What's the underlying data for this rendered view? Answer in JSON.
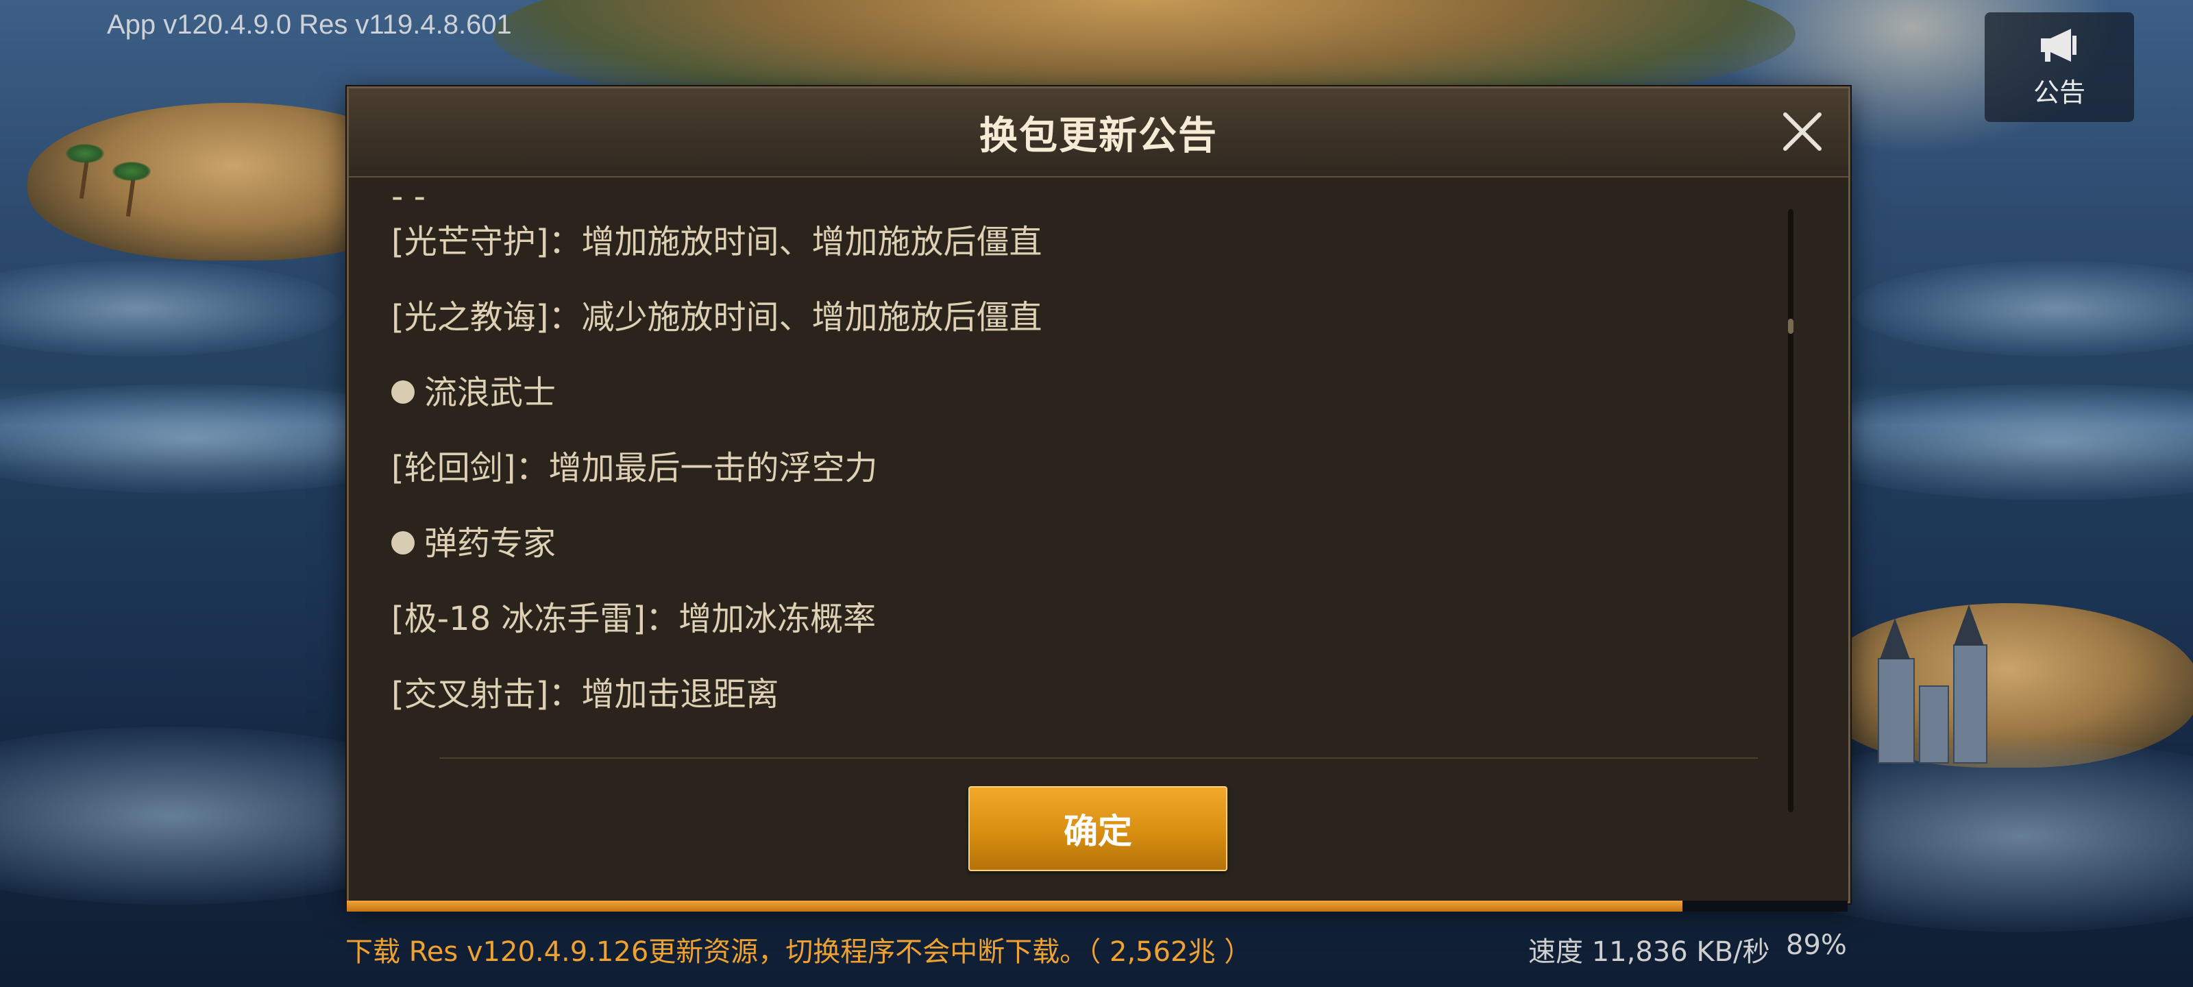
{
  "header": {
    "version_text": "App v120.4.9.0 Res v119.4.8.601",
    "notice_label": "公告"
  },
  "dialog": {
    "title": "换包更新公告",
    "lines": [
      {
        "type": "text",
        "text": "-             -"
      },
      {
        "type": "text",
        "text": "[光芒守护]：增加施放时间、增加施放后僵直"
      },
      {
        "type": "text",
        "text": "[光之教诲]：减少施放时间、增加施放后僵直"
      },
      {
        "type": "bullet",
        "text": "流浪武士"
      },
      {
        "type": "text",
        "text": "[轮回剑]：增加最后一击的浮空力"
      },
      {
        "type": "bullet",
        "text": "弹药专家"
      },
      {
        "type": "text",
        "text": "[极-18 冰冻手雷]：增加冰冻概率"
      },
      {
        "type": "text",
        "text": "[交叉射击]：增加击退距离"
      }
    ],
    "confirm_label": "确定"
  },
  "download": {
    "status_text": "下载 Res v120.4.9.126更新资源，切换程序不会中断下载。（ 2,562兆 ）",
    "speed_text": "速度 11,836 KB/秒",
    "percent_text": "89%",
    "progress": 0.89
  },
  "colors": {
    "accent": "#f0a231",
    "dialog_bg": "#2b241c",
    "button": "#d88e11"
  }
}
